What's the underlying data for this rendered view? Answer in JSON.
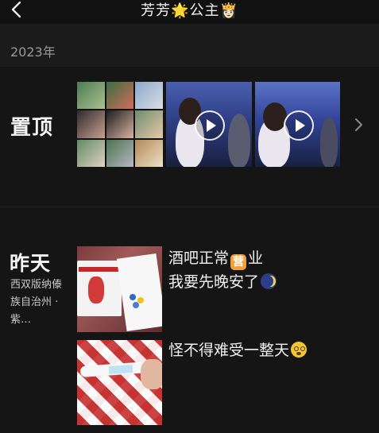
{
  "header": {
    "title": "芳芳🌟公主👸🏻"
  },
  "year_section": {
    "label": "2023年"
  },
  "pinned": {
    "label": "置顶"
  },
  "yesterday": {
    "label": "昨天",
    "location": "西双版纳傣族自治州 · 紫…",
    "post1_line1": "酒吧正常",
    "post1_emoji": "营",
    "post1_line1_end": "业",
    "post1_line2": "我要先晚安了",
    "post2_text": "怪不得难受一整天"
  },
  "colors": {
    "background": "#151515",
    "header_background": "#111111",
    "year_bar": "#1b1b1b"
  },
  "icons": {
    "back": "chevron-left-icon",
    "play": "play-icon",
    "next": "chevron-right-icon",
    "moon": "moon-emoji-icon",
    "dizzy": "dizzy-face-emoji-icon"
  }
}
